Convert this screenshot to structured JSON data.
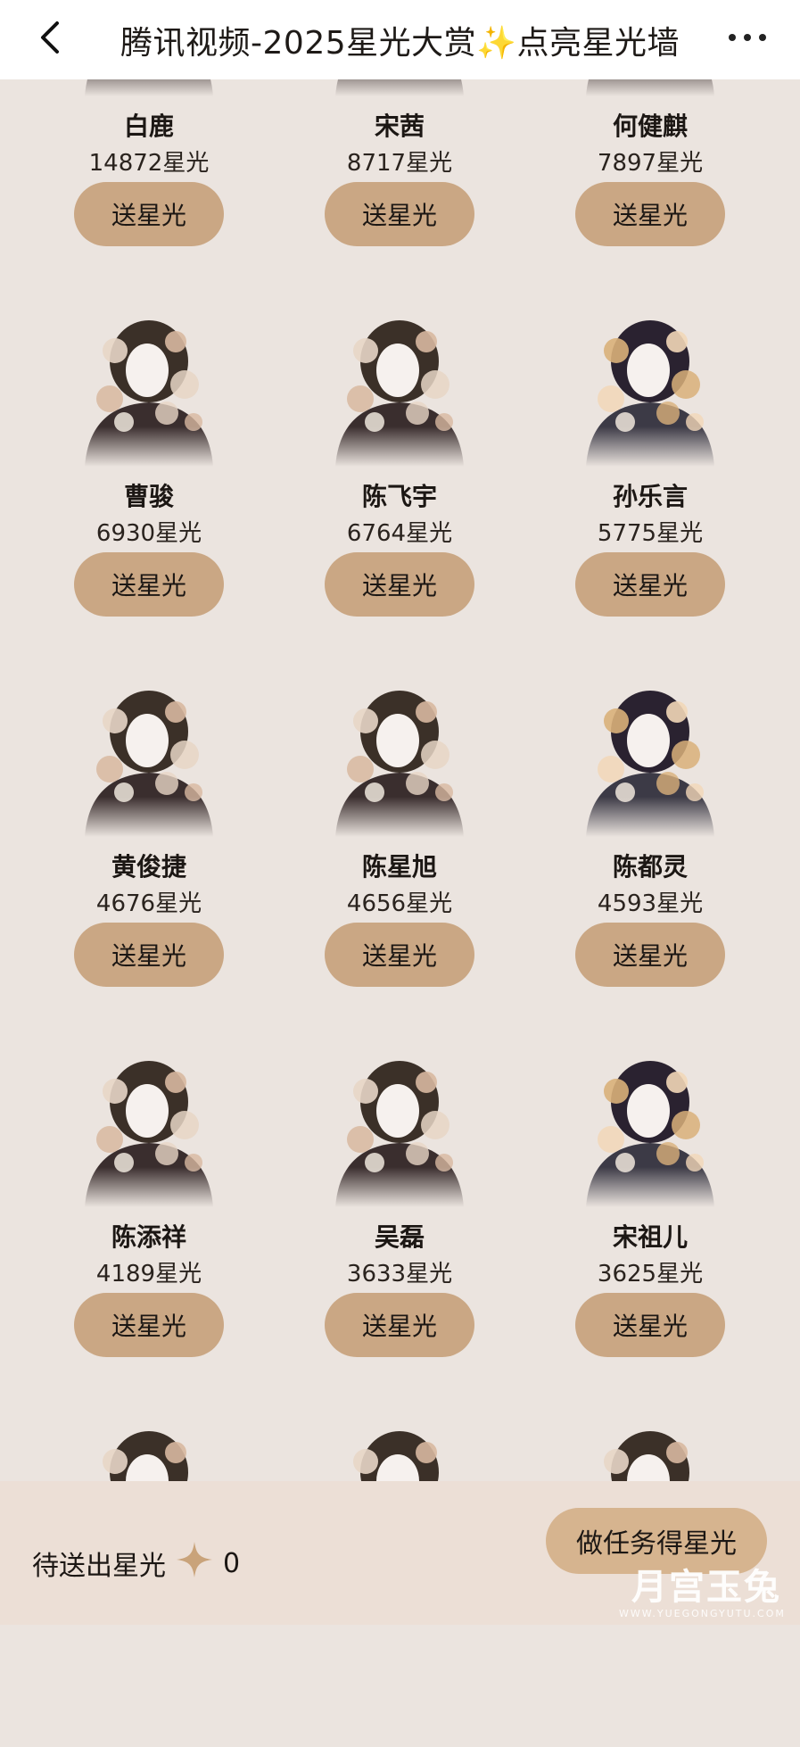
{
  "header": {
    "title": "腾讯视频-2025星光大赏✨点亮星光墙"
  },
  "cards": [
    {
      "name": "白鹿",
      "stars": "14872星光",
      "button": "送星光",
      "style": "male"
    },
    {
      "name": "宋茜",
      "stars": "8717星光",
      "button": "送星光",
      "style": "male"
    },
    {
      "name": "何健麒",
      "stars": "7897星光",
      "button": "送星光",
      "style": "male"
    },
    {
      "name": "曹骏",
      "stars": "6930星光",
      "button": "送星光",
      "style": "male"
    },
    {
      "name": "陈飞宇",
      "stars": "6764星光",
      "button": "送星光",
      "style": "male"
    },
    {
      "name": "孙乐言",
      "stars": "5775星光",
      "button": "送星光",
      "style": "female"
    },
    {
      "name": "黄俊捷",
      "stars": "4676星光",
      "button": "送星光",
      "style": "male"
    },
    {
      "name": "陈星旭",
      "stars": "4656星光",
      "button": "送星光",
      "style": "male"
    },
    {
      "name": "陈都灵",
      "stars": "4593星光",
      "button": "送星光",
      "style": "female"
    },
    {
      "name": "陈添祥",
      "stars": "4189星光",
      "button": "送星光",
      "style": "male"
    },
    {
      "name": "吴磊",
      "stars": "3633星光",
      "button": "送星光",
      "style": "male"
    },
    {
      "name": "宋祖儿",
      "stars": "3625星光",
      "button": "送星光",
      "style": "female"
    },
    {
      "name": "",
      "stars": "",
      "button": "",
      "style": "male"
    },
    {
      "name": "",
      "stars": "",
      "button": "",
      "style": "male"
    },
    {
      "name": "",
      "stars": "",
      "button": "",
      "style": "male"
    }
  ],
  "footer": {
    "pending_label": "待送出星光",
    "pending_count": "0",
    "task_button": "做任务得星光"
  },
  "watermark": {
    "main": "月宫玉兔",
    "sub": "WWW.YUEGONGYUTU.COM"
  },
  "colors": {
    "button": "#caa784",
    "background": "#ebe4df",
    "footer": "#ecdfd6"
  }
}
